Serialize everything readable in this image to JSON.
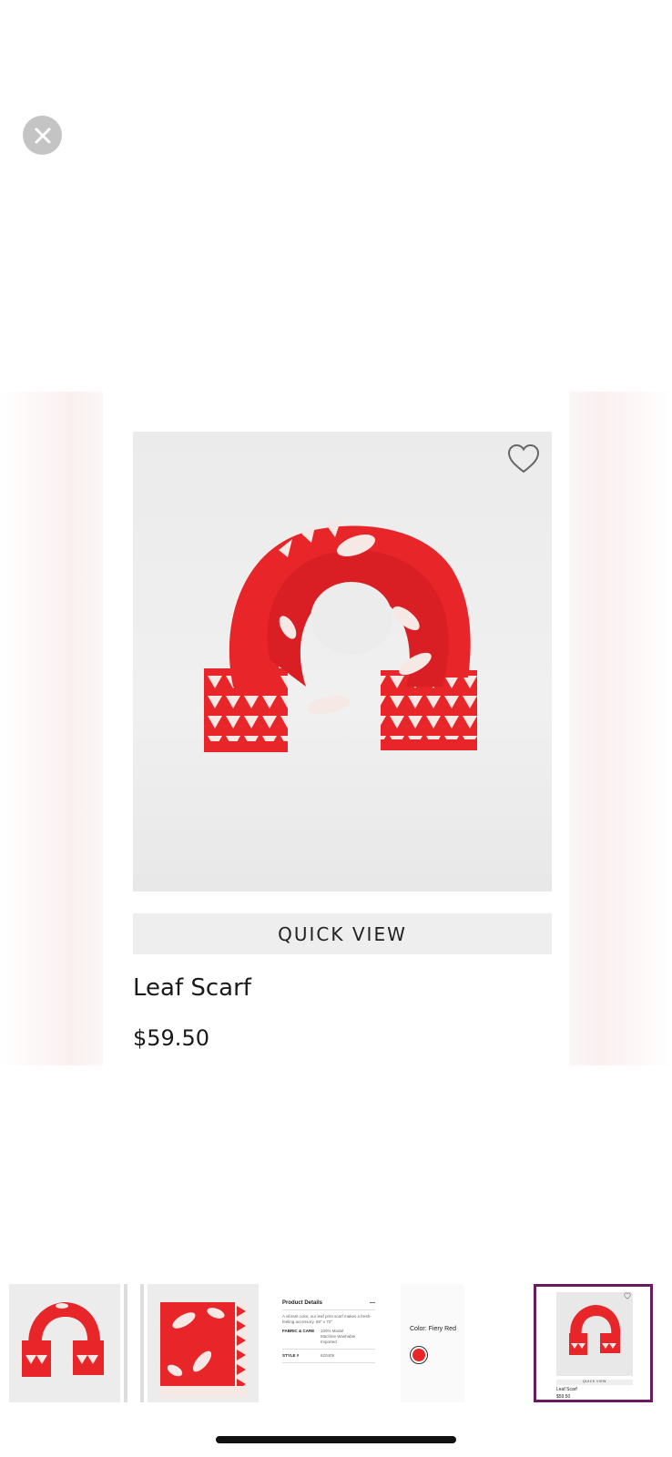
{
  "close": {
    "icon": "close-icon"
  },
  "product": {
    "name": "Leaf Scarf",
    "price": "$59.50",
    "quick_view_label": "QUICK VIEW",
    "favorite_icon": "heart-outline-icon",
    "image_color": "#e8262a"
  },
  "thumbnails": {
    "details": {
      "title": "Product Details",
      "description": "A vibrant color, our leaf print scarf makes a fresh-feeling accessory. 68\" x 72\"",
      "fabric_label": "FABRIC & CARE",
      "fabric_value": "100% Modal\nMachine Washable\nImported",
      "style_label": "STYLE #",
      "style_value": "620409"
    },
    "color": {
      "label": "Color: Fiery Red",
      "swatch": "#e8262a"
    },
    "mini_card": {
      "quick_view_label": "QUICK VIEW",
      "name": "Leaf Scarf",
      "price": "$59.50"
    }
  },
  "colors": {
    "accent_border": "#6a1b5e",
    "scarf_red": "#e8262a"
  }
}
